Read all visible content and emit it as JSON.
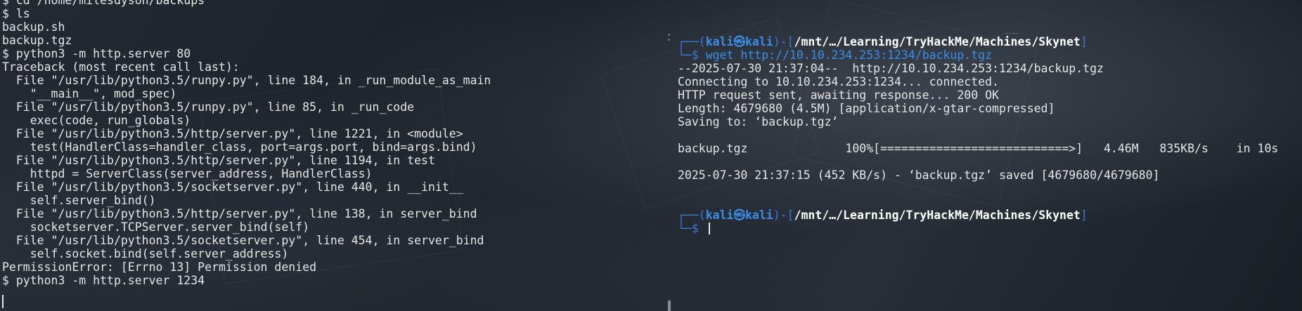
{
  "left_terminal": {
    "lines": [
      "$ cd /home/milesdyson/backups",
      "$ ls",
      "backup.sh",
      "backup.tgz",
      "$ python3 -m http.server 80",
      "Traceback (most recent call last):",
      "  File \"/usr/lib/python3.5/runpy.py\", line 184, in _run_module_as_main",
      "    \"__main__\", mod_spec)",
      "  File \"/usr/lib/python3.5/runpy.py\", line 85, in _run_code",
      "    exec(code, run_globals)",
      "  File \"/usr/lib/python3.5/http/server.py\", line 1221, in <module>",
      "    test(HandlerClass=handler_class, port=args.port, bind=args.bind)",
      "  File \"/usr/lib/python3.5/http/server.py\", line 1194, in test",
      "    httpd = ServerClass(server_address, HandlerClass)",
      "  File \"/usr/lib/python3.5/socketserver.py\", line 440, in __init__",
      "    self.server_bind()",
      "  File \"/usr/lib/python3.5/http/server.py\", line 138, in server_bind",
      "    socketserver.TCPServer.server_bind(self)",
      "  File \"/usr/lib/python3.5/socketserver.py\", line 454, in server_bind",
      "    self.socket.bind(self.server_address)",
      "PermissionError: [Errno 13] Permission denied",
      "$ python3 -m http.server 1234"
    ]
  },
  "right_terminal": {
    "prompt1": {
      "box_open": "┌──(",
      "user": "kali",
      "at": "㉿",
      "host": "kali",
      "box_mid": ")-[",
      "path": "/mnt/…/Learning/TryHackMe/Machines/Skynet",
      "box_close": "]",
      "prompt_prefix": "└─$ ",
      "command": "wget http://10.10.234.253:1234/backup.tgz"
    },
    "output": [
      "--2025-07-30 21:37:04--  http://10.10.234.253:1234/backup.tgz",
      "Connecting to 10.10.234.253:1234... connected.",
      "HTTP request sent, awaiting response... 200 OK",
      "Length: 4679680 (4.5M) [application/x-gtar-compressed]",
      "Saving to: ‘backup.tgz’",
      "",
      "backup.tgz              100%[===========================>]   4.46M   835KB/s    in 10s",
      "",
      "2025-07-30 21:37:15 (452 KB/s) - ‘backup.tgz’ saved [4679680/4679680]",
      "",
      ""
    ],
    "prompt2": {
      "box_open": "┌──(",
      "user": "kali",
      "at": "㉿",
      "host": "kali",
      "box_mid": ")-[",
      "path": "/mnt/…/Learning/TryHackMe/Machines/Skynet",
      "box_close": "]",
      "prompt_prefix": "└─$ "
    }
  },
  "colors": {
    "prompt_blue": "#3b8eea",
    "text": "#e6e6e6"
  }
}
